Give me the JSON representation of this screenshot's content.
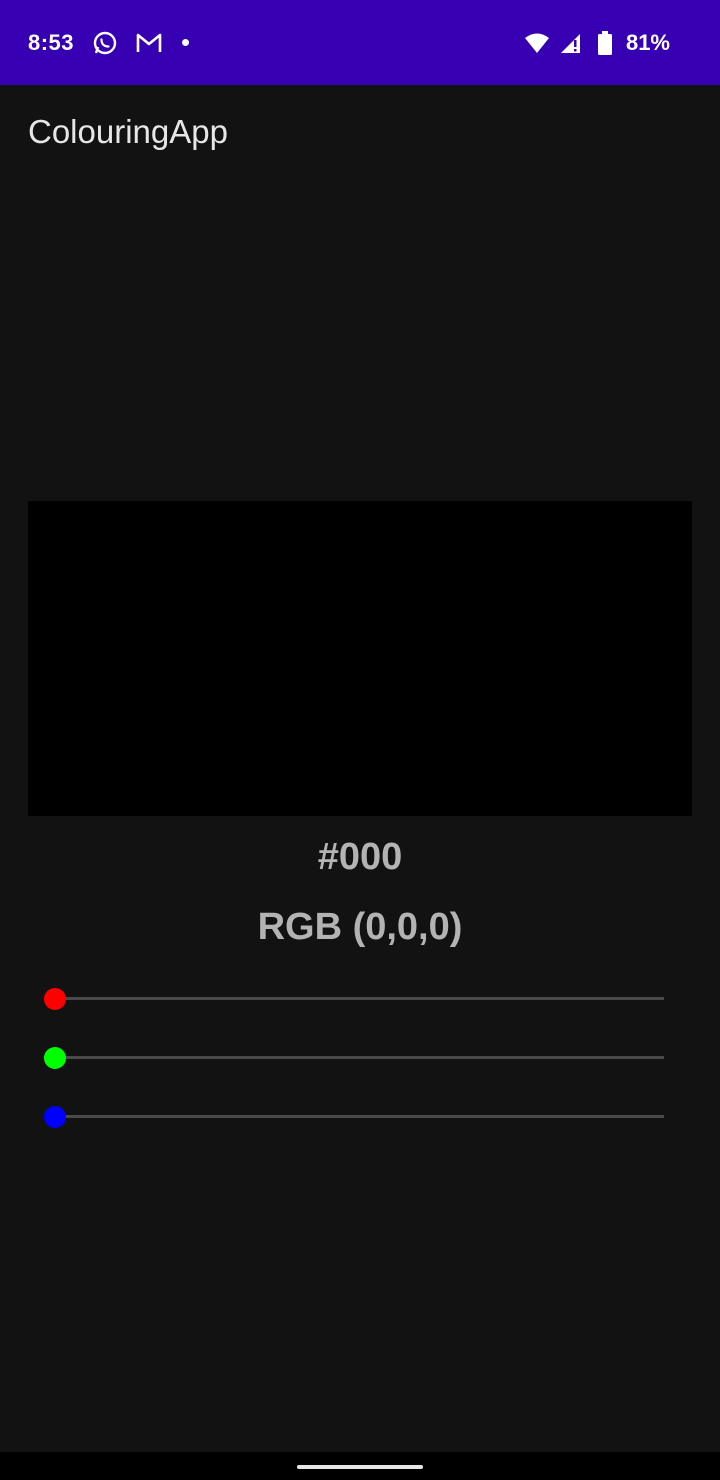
{
  "status_bar": {
    "time": "8:53",
    "battery": "81%",
    "icons": [
      "whatsapp-icon",
      "gmail-icon",
      "notification-dot-icon",
      "wifi-icon",
      "signal-icon",
      "battery-icon"
    ],
    "background": "#3700b3"
  },
  "app": {
    "title": "ColouringApp"
  },
  "preview": {
    "color": "#000000"
  },
  "labels": {
    "hex": "#000",
    "rgb": "RGB (0,0,0)"
  },
  "sliders": [
    {
      "name": "red",
      "color": "#ff0000",
      "value": 0,
      "max": 255
    },
    {
      "name": "green",
      "color": "#00ff00",
      "value": 0,
      "max": 255
    },
    {
      "name": "blue",
      "color": "#0000ff",
      "value": 0,
      "max": 255
    }
  ]
}
